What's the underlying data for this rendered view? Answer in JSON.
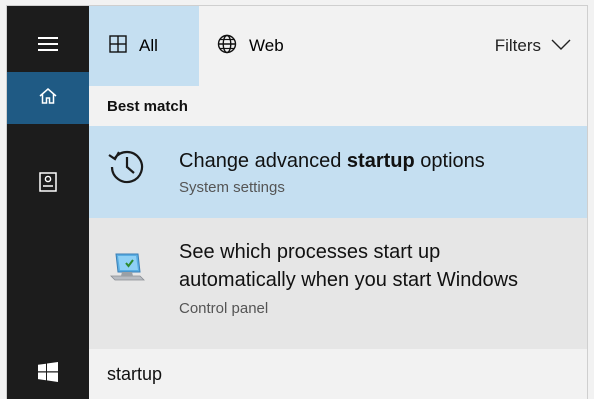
{
  "rail": {
    "items": [
      {
        "name": "hamburger-icon"
      },
      {
        "name": "home-icon"
      },
      {
        "name": "notebook-icon"
      },
      {
        "name": "windows-logo-icon"
      }
    ]
  },
  "tabs": {
    "all_label": "All",
    "web_label": "Web",
    "filters_label": "Filters"
  },
  "section": {
    "best_match": "Best match"
  },
  "results": [
    {
      "title_pre": "Change advanced ",
      "title_bold": "startup",
      "title_post": " options",
      "subtitle": "System settings",
      "icon": "history-clock-icon"
    },
    {
      "title_line1": "See which processes start up",
      "title_line2": "automatically when you start Windows",
      "subtitle": "Control panel",
      "icon": "monitor-checkmark-icon"
    }
  ],
  "search": {
    "value": "startup"
  },
  "colors": {
    "rail_bg": "#1c1c1c",
    "rail_active": "#1f5a84",
    "selection": "#c5dff1",
    "panel_bg": "#f2f2f2"
  }
}
